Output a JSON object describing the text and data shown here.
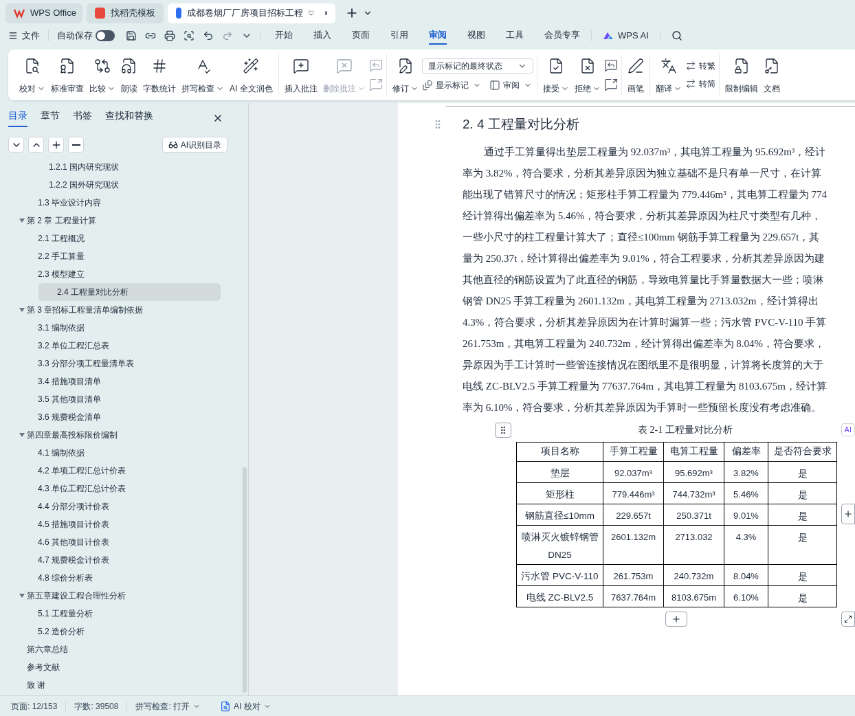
{
  "window_tabs": [
    {
      "label": "WPS Office",
      "selected": false
    },
    {
      "label": "找稻壳模板",
      "selected": false
    },
    {
      "label": "成都卷烟厂厂房项目招标工程",
      "selected": true
    }
  ],
  "menu": {
    "file": "文件",
    "autosave": {
      "label": "自动保存",
      "on": false
    },
    "tabs": [
      {
        "label": "开始",
        "selected": false
      },
      {
        "label": "插入",
        "selected": false
      },
      {
        "label": "页面",
        "selected": false
      },
      {
        "label": "引用",
        "selected": false
      },
      {
        "label": "审阅",
        "selected": true
      },
      {
        "label": "视图",
        "selected": false
      },
      {
        "label": "工具",
        "selected": false
      },
      {
        "label": "会员专享",
        "selected": false
      }
    ],
    "ai": "WPS AI"
  },
  "ribbon": [
    {
      "items": [
        {
          "kind": "large",
          "label": "校对",
          "dropdown": true,
          "disabled": false
        },
        {
          "kind": "large",
          "label": "标准审查",
          "dropdown": false,
          "disabled": false
        },
        {
          "kind": "large",
          "label": "比较",
          "dropdown": true,
          "disabled": false
        },
        {
          "kind": "large",
          "label": "朗读",
          "dropdown": false,
          "disabled": false
        },
        {
          "kind": "large",
          "label": "字数统计",
          "dropdown": false,
          "disabled": false
        },
        {
          "kind": "large",
          "label": "拼写检查",
          "dropdown": true,
          "disabled": false
        },
        {
          "kind": "large",
          "label": "AI 全文润色",
          "dropdown": false,
          "disabled": false
        }
      ]
    },
    {
      "items": [
        {
          "kind": "large",
          "label": "插入批注",
          "dropdown": false,
          "disabled": false
        },
        {
          "kind": "large",
          "label": "删除批注",
          "dropdown": true,
          "disabled": true
        },
        {
          "kind": "icons",
          "disabled": true
        }
      ]
    },
    {
      "items": [
        {
          "kind": "large",
          "label": "修订",
          "dropdown": true,
          "disabled": false
        },
        {
          "kind": "stack",
          "select": "显示标记的最终状态",
          "small": [
            {
              "label": "显示标记",
              "dropdown": true
            },
            {
              "label": "审阅",
              "dropdown": true
            }
          ]
        }
      ]
    },
    {
      "items": [
        {
          "kind": "large",
          "label": "接受",
          "dropdown": true,
          "disabled": false
        },
        {
          "kind": "large",
          "label": "拒绝",
          "dropdown": true,
          "disabled": false
        },
        {
          "kind": "icons",
          "disabled": false
        }
      ]
    },
    {
      "items": [
        {
          "kind": "large",
          "label": "画笔",
          "dropdown": false,
          "disabled": false
        }
      ]
    },
    {
      "items": [
        {
          "kind": "large",
          "label": "翻译",
          "dropdown": true,
          "disabled": false
        },
        {
          "kind": "pair",
          "small": [
            {
              "label": "转繁",
              "dropdown": false
            },
            {
              "label": "转简",
              "dropdown": false
            }
          ]
        }
      ]
    },
    {
      "items": [
        {
          "kind": "large",
          "label": "限制编辑",
          "dropdown": false,
          "disabled": false
        },
        {
          "kind": "large",
          "label": "文档",
          "dropdown": false,
          "disabled": false
        }
      ]
    }
  ],
  "sidebar": {
    "tabs": [
      {
        "label": "目录",
        "selected": true
      },
      {
        "label": "章节",
        "selected": false
      },
      {
        "label": "书签",
        "selected": false
      },
      {
        "label": "查找和替换",
        "selected": false
      }
    ],
    "ai_button": "AI识别目录",
    "toc": [
      {
        "children": [
          {
            "children": [
              {
                "label": "1.2.1 国内研究现状",
                "selected": false
              },
              {
                "label": "1.2.2 国外研究现状",
                "selected": false
              }
            ]
          },
          {
            "label": "1.3 毕业设计内容",
            "selected": false
          }
        ]
      },
      {
        "label": "第 2 章  工程量计算",
        "selected": false,
        "expanded": true,
        "children": [
          {
            "label": "2.1  工程概况",
            "selected": false
          },
          {
            "label": "2.2  手工算量",
            "selected": false
          },
          {
            "label": "2.3 模型建立",
            "selected": false
          },
          {
            "label": "2.4 工程量对比分析",
            "selected": true
          }
        ]
      },
      {
        "label": "第 3 章招标工程量清单编制依据",
        "selected": false,
        "expanded": true,
        "children": [
          {
            "label": "3.1 编制依据",
            "selected": false
          },
          {
            "label": "3.2 单位工程汇总表",
            "selected": false
          },
          {
            "label": "3.3 分部分项工程量清单表",
            "selected": false
          },
          {
            "label": "3.4 措施项目清单",
            "selected": false
          },
          {
            "label": "3.5 其他项目清单",
            "selected": false
          },
          {
            "label": "3.6 规费税金清单",
            "selected": false
          }
        ]
      },
      {
        "label": "第四章最高投标限价编制",
        "selected": false,
        "expanded": true,
        "children": [
          {
            "label": "4.1 编制依据",
            "selected": false
          },
          {
            "label": "4.2 单项工程汇总计价表",
            "selected": false
          },
          {
            "label": "4.3 单位工程汇总计价表",
            "selected": false
          },
          {
            "label": "4.4 分部分项计价表",
            "selected": false
          },
          {
            "label": "4.5 措施项目计价表",
            "selected": false
          },
          {
            "label": "4.6 其他项目计价表",
            "selected": false
          },
          {
            "label": "4.7 规费税金计价表",
            "selected": false
          },
          {
            "label": "4.8 综价分析表",
            "selected": false
          }
        ]
      },
      {
        "label": "第五章建设工程合理性分析",
        "selected": false,
        "expanded": true,
        "children": [
          {
            "label": "5.1 工程量分析",
            "selected": false
          },
          {
            "label": "5.2 造价分析",
            "selected": false
          }
        ]
      },
      {
        "label": "第六章总结",
        "selected": false
      },
      {
        "label": "参考文献",
        "selected": false
      },
      {
        "label": "致    谢",
        "selected": false
      }
    ]
  },
  "document": {
    "heading": "2. 4 工程量对比分析",
    "lines": [
      "通过手工算量得出垫层工程量为 92.037m³，其电算工程量为 95.692m³，经计",
      "率为 3.82%，符合要求，分析其差异原因为独立基础不是只有单一尺寸，在计算",
      "能出现了错算尺寸的情况；矩形柱手算工程量为 779.446m³，其电算工程量为 774",
      "经计算得出偏差率为 5.46%，符合要求，分析其差异原因为柱尺寸类型有几种，",
      "一些小尺寸的柱工程量计算大了；直径≤100mm 钢筋手算工程量为 229.657t，其",
      "量为 250.37t，经计算得出偏差率为 9.01%，符合工程要求，分析其差异原因为建",
      "其他直径的钢筋设置为了此直径的钢筋，导致电算量比手算量数据大一些；喷淋",
      "钢管 DN25 手算工程量为 2601.132m，其电算工程量为 2713.032m，经计算得出",
      "4.3%，符合要求，分析其差异原因为在计算时漏算一些；污水管 PVC-V-110 手算",
      "261.753m，其电算工程量为 240.732m，经计算得出偏差率为 8.04%，符合要求，",
      "异原因为手工计算时一些管连接情况在图纸里不是很明显，计算将长度算的大于",
      "电线 ZC-BLV2.5 手算工程量为 77637.764m，其电算工程量为 8103.675m，经计算",
      "率为 6.10%，符合要求，分析其差异原因为手算时一些预留长度没有考虑准确。"
    ],
    "table_caption": "表 2-1  工程量对比分析",
    "table": {
      "columns": [
        "项目名称",
        "手算工程量",
        "电算工程量",
        "偏差率",
        "是否符合要求"
      ],
      "rows": [
        [
          "垫层",
          "92.037m³",
          "95.692m³",
          "3.82%",
          "是"
        ],
        [
          "矩形柱",
          "779.446m³",
          "744.732m³",
          "5.46%",
          "是"
        ],
        [
          "钢筋直径≤10mm",
          "229.657t",
          "250.371t",
          "9.01%",
          "是"
        ],
        [
          "喷淋灭火镀锌钢管 DN25",
          "2601.132m",
          "2713.032",
          "4.3%",
          "是"
        ],
        [
          "污水管 PVC-V-110",
          "261.753m",
          "240.732m",
          "8.04%",
          "是"
        ],
        [
          "电线 ZC-BLV2.5",
          "7637.764m",
          "8103.675m",
          "6.10%",
          "是"
        ]
      ]
    },
    "ai_tag": "AI"
  },
  "status_bar": {
    "page": "页面: 12/153",
    "words": "字数: 39508",
    "spell": "拼写检查: 打开",
    "ai_check": "AI 校对"
  }
}
